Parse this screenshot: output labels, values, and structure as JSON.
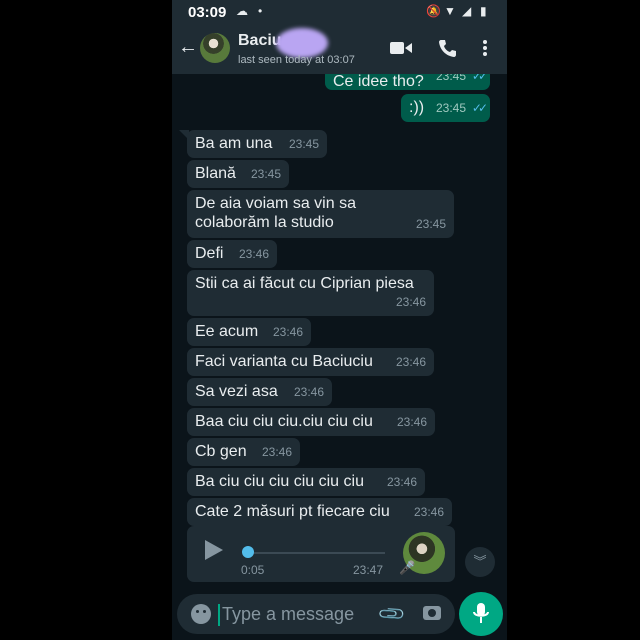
{
  "status_bar": {
    "time": "03:09"
  },
  "header": {
    "contact_name": "Baciu",
    "last_seen": "last seen today at 03:07"
  },
  "messages": [
    {
      "dir": "out",
      "text": "Ce idee tho?",
      "time": "23:45",
      "read": true
    },
    {
      "dir": "out",
      "text": ":))",
      "time": "23:45",
      "read": true
    },
    {
      "dir": "in",
      "text": "Ba am una",
      "time": "23:45"
    },
    {
      "dir": "in",
      "text": "Blană",
      "time": "23:45"
    },
    {
      "dir": "in",
      "text_line1": "De aia voiam sa vin sa",
      "text_line2": "colaborăm la studio",
      "time": "23:45"
    },
    {
      "dir": "in",
      "text": "Defi",
      "time": "23:46"
    },
    {
      "dir": "in",
      "text": "Stii ca ai făcut cu Ciprian piesa",
      "time": "23:46"
    },
    {
      "dir": "in",
      "text": "Ee acum",
      "time": "23:46"
    },
    {
      "dir": "in",
      "text": "Faci varianta cu Baciuciu",
      "time": "23:46"
    },
    {
      "dir": "in",
      "text": "Sa vezi asa",
      "time": "23:46"
    },
    {
      "dir": "in",
      "text": "Baa ciu ciu ciu.ciu ciu ciu",
      "time": "23:46"
    },
    {
      "dir": "in",
      "text": "Cb gen",
      "time": "23:46"
    },
    {
      "dir": "in",
      "text": "Ba ciu ciu ciu ciu ciu ciu",
      "time": "23:46"
    },
    {
      "dir": "in",
      "text": "Cate 2 măsuri pt fiecare ciu",
      "time": "23:46"
    }
  ],
  "voice_message": {
    "duration": "0:05",
    "time": "23:47",
    "progress": 0
  },
  "composer": {
    "placeholder": "Type a message"
  },
  "icons": {
    "back": "arrow-left-icon",
    "video": "video-call-icon",
    "call": "phone-icon",
    "menu": "more-vert-icon",
    "emoji": "emoji-icon",
    "attach": "paperclip-icon",
    "camera": "camera-icon",
    "mic": "mic-icon",
    "scroll": "double-chevron-down-icon"
  },
  "colors": {
    "background": "#0b141a",
    "bar": "#1f2c34",
    "incoming": "#1f2c34",
    "outgoing": "#005c4b",
    "accent": "#00a884",
    "read_ticks": "#53bdeb"
  }
}
